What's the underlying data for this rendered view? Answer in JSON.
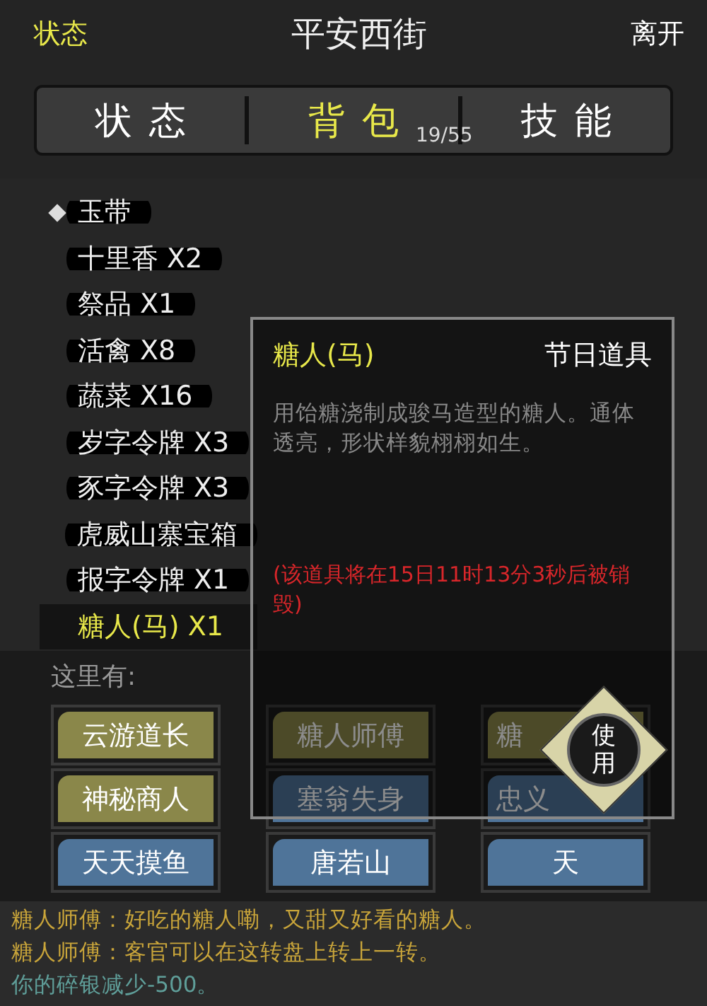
{
  "header": {
    "left_link": "状态",
    "title": "平安西街",
    "right_link": "离开"
  },
  "tabs": [
    {
      "label": "状态",
      "selected": false
    },
    {
      "label": "背包",
      "selected": true,
      "count": "19/55"
    },
    {
      "label": "技能",
      "selected": false
    }
  ],
  "inventory": [
    {
      "label": "玉带",
      "marked": true,
      "selected": false
    },
    {
      "label": "十里香 X2",
      "marked": false,
      "selected": false
    },
    {
      "label": "祭品 X1",
      "marked": false,
      "selected": false
    },
    {
      "label": "活禽 X8",
      "marked": false,
      "selected": false
    },
    {
      "label": "蔬菜 X16",
      "marked": false,
      "selected": false
    },
    {
      "label": "岁字令牌 X3",
      "marked": false,
      "selected": false
    },
    {
      "label": "豕字令牌 X3",
      "marked": false,
      "selected": false
    },
    {
      "label": "虎威山寨宝箱",
      "marked": false,
      "selected": false
    },
    {
      "label": "报字令牌 X1",
      "marked": false,
      "selected": false
    },
    {
      "label": "糖人(马) X1",
      "marked": false,
      "selected": true
    }
  ],
  "here_label": "这里有:",
  "npcs": [
    {
      "label": "云游道长",
      "kind": "npc",
      "cut": false
    },
    {
      "label": "糖人师傅",
      "kind": "npc",
      "cut": false
    },
    {
      "label": "糖",
      "kind": "npc",
      "cut": true
    },
    {
      "label": "神秘商人",
      "kind": "npc",
      "cut": false
    },
    {
      "label": "塞翁失身",
      "kind": "player",
      "cut": false
    },
    {
      "label": "忠义",
      "kind": "player",
      "cut": true
    },
    {
      "label": "天天摸鱼",
      "kind": "player",
      "cut": false
    },
    {
      "label": "唐若山",
      "kind": "player",
      "cut": false
    },
    {
      "label": "天",
      "kind": "player",
      "cut": false
    }
  ],
  "chat": [
    {
      "kind": "speech",
      "text": "糖人师傅：好吃的糖人嘞，又甜又好看的糖人。"
    },
    {
      "kind": "speech",
      "text": "糖人师傅：客官可以在这转盘上转上一转。"
    },
    {
      "kind": "system",
      "text": "你的碎银减少-500。"
    }
  ],
  "popup": {
    "name": "糖人(马)",
    "category": "节日道具",
    "description": "用饴糖浇制成骏马造型的糖人。通体透亮，形状样貌栩栩如生。",
    "warning": "(该道具将在15日11时13分3秒后被销毁)",
    "use_button": "使用"
  }
}
